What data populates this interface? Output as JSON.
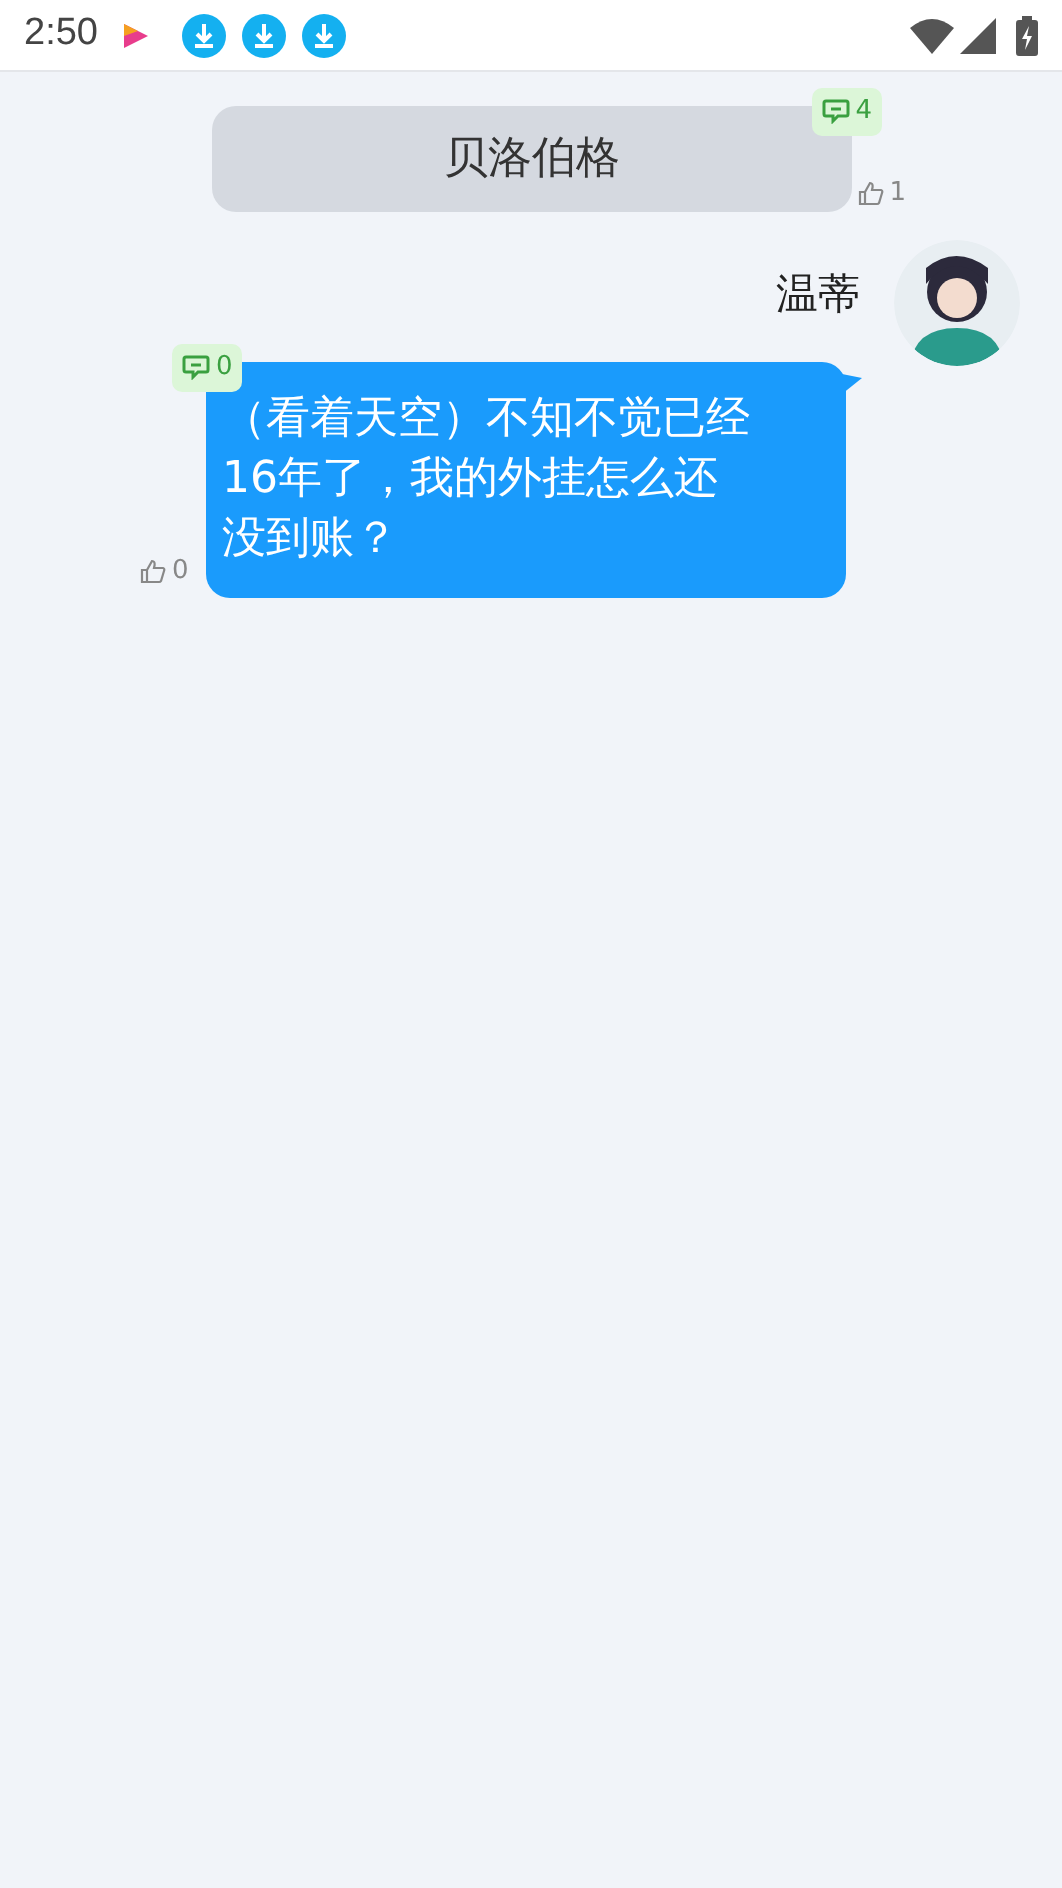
{
  "status_bar": {
    "time": "2:50"
  },
  "messages": [
    {
      "kind": "narration",
      "text": "贝洛伯格",
      "comments": "4",
      "likes": "1"
    },
    {
      "kind": "character",
      "speaker": "温蒂",
      "text": "（看着天空）不知不觉已经16年了，我的外挂怎么还没到账？",
      "comments": "0",
      "likes": "0"
    }
  ]
}
